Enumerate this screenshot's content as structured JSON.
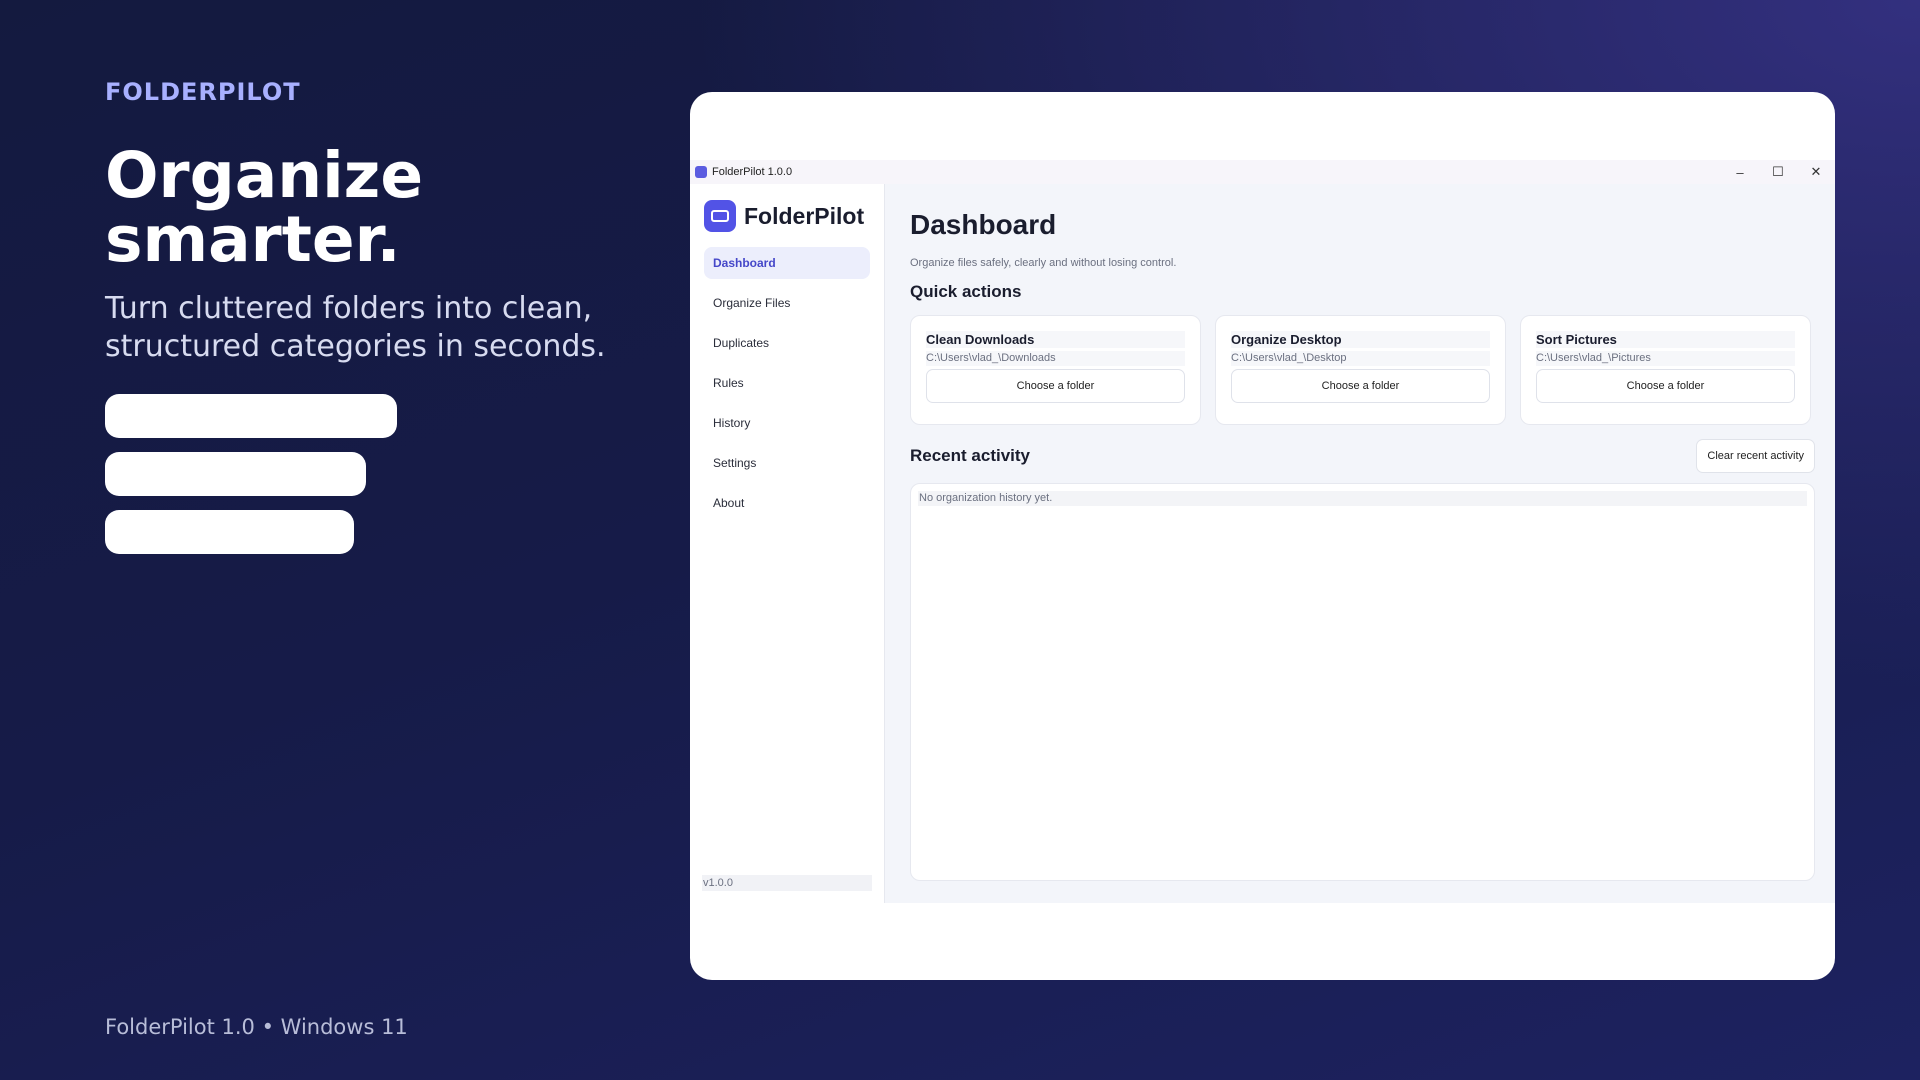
{
  "hero": {
    "brand": "FOLDERPILOT",
    "headline": "Organize smarter.",
    "subline": "Turn cluttered folders into clean, structured categories in seconds.",
    "footer": "FolderPilot 1.0 • Windows 11"
  },
  "window": {
    "title": "FolderPilot 1.0.0",
    "minimize_glyph": "–",
    "maximize_glyph": "☐",
    "close_glyph": "✕"
  },
  "sidebar": {
    "app_name": "FolderPilot",
    "items": [
      {
        "label": "Dashboard",
        "active": true
      },
      {
        "label": "Organize Files"
      },
      {
        "label": "Duplicates"
      },
      {
        "label": "Rules"
      },
      {
        "label": "History"
      },
      {
        "label": "Settings"
      },
      {
        "label": "About"
      }
    ],
    "version": "v1.0.0"
  },
  "main": {
    "title": "Dashboard",
    "subtitle": "Organize files safely, clearly and without losing control.",
    "quick_actions_title": "Quick actions",
    "cards": [
      {
        "title": "Clean Downloads",
        "path": "C:\\Users\\vlad_\\Downloads",
        "button": "Choose a folder"
      },
      {
        "title": "Organize Desktop",
        "path": "C:\\Users\\vlad_\\Desktop",
        "button": "Choose a folder"
      },
      {
        "title": "Sort Pictures",
        "path": "C:\\Users\\vlad_\\Pictures",
        "button": "Choose a folder"
      }
    ],
    "recent_title": "Recent activity",
    "clear_button": "Clear recent activity",
    "empty_text": "No organization history yet."
  },
  "colors": {
    "accent": "#5253e6",
    "background_dark": "#161b48",
    "brand_text": "#a8b0ff"
  }
}
